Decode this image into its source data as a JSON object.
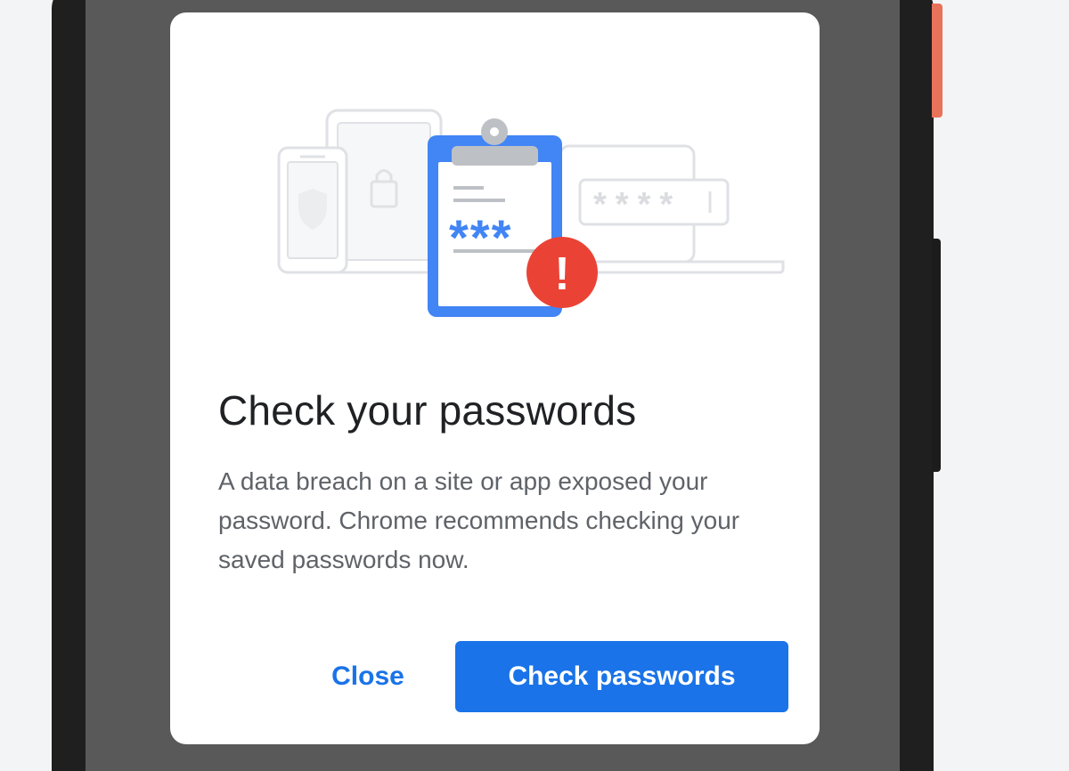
{
  "dialog": {
    "title": "Check your passwords",
    "body": "A data breach on a site or app exposed your password. Chrome recommends checking your saved passwords now.",
    "close_label": "Close",
    "primary_label": "Check passwords"
  },
  "illustration": {
    "clipboard_text": "***",
    "field_text": "****",
    "alert_glyph": "!"
  },
  "icons": [
    "phone-icon",
    "tablet-icon",
    "laptop-icon",
    "shield-icon",
    "lock-icon",
    "clipboard-icon",
    "alert-icon"
  ],
  "colors": {
    "accent": "#1a73e8",
    "clipboard_blue": "#4285f4",
    "alert_red": "#ea4335",
    "outline_gray": "#dadce0",
    "screen_gray": "#595959",
    "title_text": "#202124",
    "body_text": "#5f6368"
  }
}
